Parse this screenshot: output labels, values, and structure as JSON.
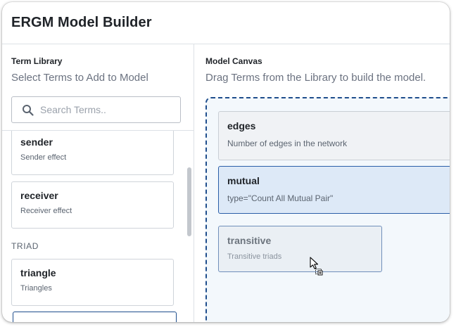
{
  "app": {
    "title": "ERGM Model Builder"
  },
  "library": {
    "title": "Term Library",
    "subtitle": "Select Terms to Add to Model",
    "search_placeholder": "Search Terms..",
    "terms_top": [
      {
        "name": "sender",
        "description": "Sender effect"
      },
      {
        "name": "receiver",
        "description": "Receiver effect"
      }
    ],
    "section_triad": "TRIAD",
    "terms_triad": [
      {
        "name": "triangle",
        "description": "Triangles"
      }
    ]
  },
  "canvas": {
    "title": "Model Canvas",
    "subtitle": "Drag Terms from the Library to build the model.",
    "terms": [
      {
        "name": "edges",
        "description": "Number of edges in the network"
      },
      {
        "name": "mutual",
        "description": "type=\"Count All Mutual Pair\""
      }
    ],
    "dragging_term": {
      "name": "transitive",
      "description": "Transitive triads"
    }
  },
  "colors": {
    "accent": "#1e4d8c",
    "selected_card_bg": "#dde9f7",
    "canvas_bg": "#f3f8fc"
  },
  "icons": {
    "search": "search-icon",
    "cursor": "drag-copy-cursor-icon"
  }
}
